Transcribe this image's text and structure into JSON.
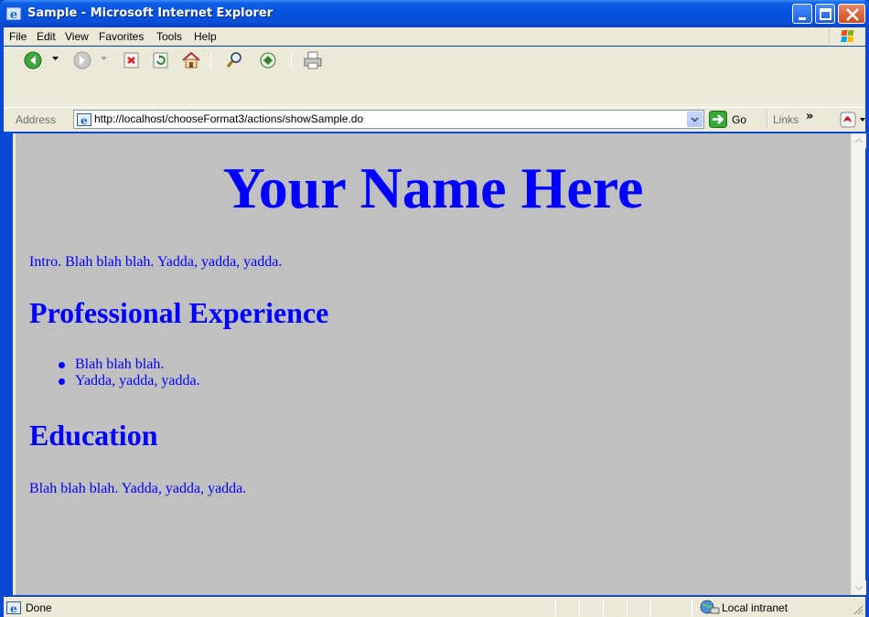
{
  "window": {
    "title": "Sample - Microsoft Internet Explorer"
  },
  "menu": {
    "items": [
      "File",
      "Edit",
      "View",
      "Favorites",
      "Tools",
      "Help"
    ]
  },
  "toolbar": {
    "icons": [
      "back-icon",
      "forward-icon",
      "stop-icon",
      "refresh-icon",
      "home-icon",
      "search-icon",
      "favorites-icon",
      "print-icon"
    ]
  },
  "addressbar": {
    "label": "Address",
    "url": "http://localhost/chooseFormat3/actions/showSample.do",
    "go_label": "Go",
    "links_label": "Links",
    "links_chevron": "»"
  },
  "page": {
    "title": "Your Name Here",
    "intro": "Intro. Blah blah blah. Yadda, yadda, yadda.",
    "experience_heading": "Professional Experience",
    "experience_items": [
      "Blah blah blah.",
      "Yadda, yadda, yadda."
    ],
    "education_heading": "Education",
    "education_text": "Blah blah blah. Yadda, yadda, yadda."
  },
  "statusbar": {
    "status": "Done",
    "zone": "Local intranet"
  },
  "colors": {
    "page_background": "#c0c0c0",
    "page_text": "#0000ff",
    "titlebar": "#0551e0"
  }
}
